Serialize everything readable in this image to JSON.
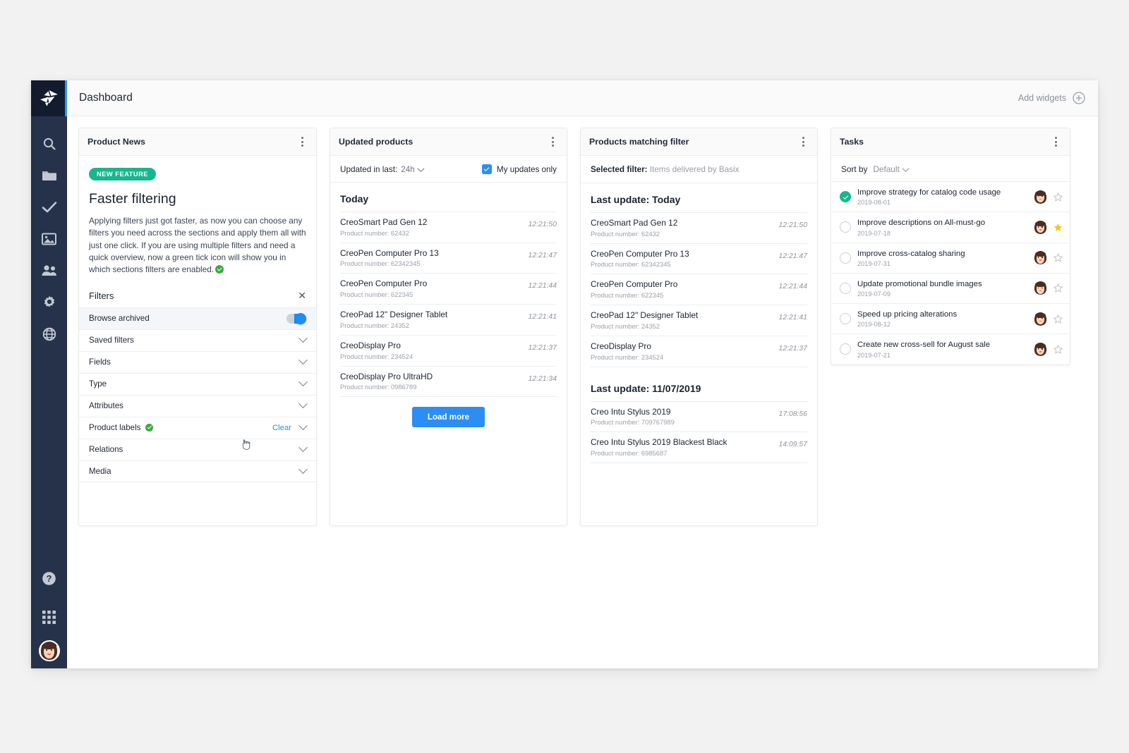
{
  "app": {
    "logo_icon": "origami-bird-logo-icon"
  },
  "sidebar": {
    "items": [
      {
        "name": "search",
        "icon": "search-icon"
      },
      {
        "name": "catalogs",
        "icon": "folder-icon"
      },
      {
        "name": "tasks",
        "icon": "check-icon"
      },
      {
        "name": "media",
        "icon": "image-icon"
      },
      {
        "name": "users",
        "icon": "users-icon"
      },
      {
        "name": "settings",
        "icon": "gear-icon"
      },
      {
        "name": "global",
        "icon": "globe-icon"
      }
    ],
    "bottom": [
      {
        "name": "help",
        "icon": "question-circle-icon"
      },
      {
        "name": "app-grid",
        "icon": "grid-apps-icon"
      },
      {
        "name": "profile",
        "icon": "avatar-icon"
      }
    ]
  },
  "topbar": {
    "title": "Dashboard",
    "add_widgets_label": "Add widgets",
    "add_widgets_icon": "plus-circle-icon"
  },
  "widgets": {
    "product_news": {
      "title": "Product News",
      "badge": "NEW FEATURE",
      "heading": "Faster filtering",
      "body": "Applying filters just got faster, as now you can choose any filters you need across the sections and apply them all with just one click. If you are using multiple filters and need a quick overview, now a green tick icon will show you in which sections filters are enabled.",
      "filters": {
        "title": "Filters",
        "close_icon": "close-icon",
        "rows": [
          {
            "label": "Browse archived",
            "type": "toggle",
            "toggle_on": true,
            "active": true
          },
          {
            "label": "Saved filters",
            "type": "chevron"
          },
          {
            "label": "Fields",
            "type": "chevron"
          },
          {
            "label": "Type",
            "type": "chevron"
          },
          {
            "label": "Attributes",
            "type": "chevron"
          },
          {
            "label": "Product labels",
            "type": "chevron",
            "tick": true,
            "clear_label": "Clear",
            "cursor": true
          },
          {
            "label": "Relations",
            "type": "chevron"
          },
          {
            "label": "Media",
            "type": "chevron"
          }
        ]
      }
    },
    "updated_products": {
      "title": "Updated products",
      "updated_in_last_label": "Updated in last:",
      "updated_in_last_value": "24h",
      "my_updates_label": "My updates only",
      "my_updates_checked": true,
      "group_label": "Today",
      "items": [
        {
          "name": "CreoSmart Pad Gen 12",
          "number": "Product number: 62432",
          "time": "12:21:50"
        },
        {
          "name": "CreoPen Computer Pro 13",
          "number": "Product number: 62342345",
          "time": "12:21:47"
        },
        {
          "name": "CreoPen Computer Pro",
          "number": "Product number: 622345",
          "time": "12:21:44"
        },
        {
          "name": "CreoPad 12\" Designer Tablet",
          "number": "Product number: 24352",
          "time": "12:21:41"
        },
        {
          "name": "CreoDisplay Pro",
          "number": "Product number: 234524",
          "time": "12:21:37"
        },
        {
          "name": "CreoDisplay Pro UltraHD",
          "number": "Product number: 0986789",
          "time": "12:21:34"
        }
      ],
      "load_more_label": "Load more"
    },
    "products_matching_filter": {
      "title": "Products matching filter",
      "selected_filter_label": "Selected filter:",
      "selected_filter_value": "Items delivered by Basix",
      "groups": [
        {
          "label": "Last update: Today",
          "items": [
            {
              "name": "CreoSmart Pad Gen 12",
              "number": "Product number: 62432",
              "time": "12:21:50"
            },
            {
              "name": "CreoPen Computer Pro 13",
              "number": "Product number: 62342345",
              "time": "12:21:47"
            },
            {
              "name": "CreoPen Computer Pro",
              "number": "Product number: 622345",
              "time": "12:21:44"
            },
            {
              "name": "CreoPad 12\" Designer Tablet",
              "number": "Product number: 24352",
              "time": "12:21:41"
            },
            {
              "name": "CreoDisplay Pro",
              "number": "Product number: 234524",
              "time": "12:21:37"
            }
          ]
        },
        {
          "label": "Last update: 11/07/2019",
          "items": [
            {
              "name": "Creo Intu Stylus 2019",
              "number": "Product number: 709767989",
              "time": "17:08:56"
            },
            {
              "name": "Creo Intu Stylus 2019 Blackest Black",
              "number": "Product number: 6985687",
              "time": "14:09:57"
            }
          ]
        }
      ]
    },
    "tasks": {
      "title": "Tasks",
      "sort_by_label": "Sort by",
      "sort_by_value": "Default",
      "items": [
        {
          "title": "Improve strategy for catalog code usage",
          "date": "2019-08-01",
          "done": true,
          "starred": false
        },
        {
          "title": "Improve descriptions on All-must-go",
          "date": "2019-07-18",
          "done": false,
          "starred": true
        },
        {
          "title": "Improve cross-catalog sharing",
          "date": "2019-07-31",
          "done": false,
          "starred": false
        },
        {
          "title": "Update promotional bundle images",
          "date": "2019-07-09",
          "done": false,
          "starred": false
        },
        {
          "title": "Speed up pricing alterations",
          "date": "2019-08-12",
          "done": false,
          "starred": false
        },
        {
          "title": "Create new cross-sell for August sale",
          "date": "2019-07-21",
          "done": false,
          "starred": false
        }
      ]
    }
  },
  "colors": {
    "accent_blue": "#2b8ef5",
    "green": "#15b88a",
    "tick_green": "#3bab3f",
    "sidebar": "#26324a",
    "star_yellow": "#f5c518"
  }
}
